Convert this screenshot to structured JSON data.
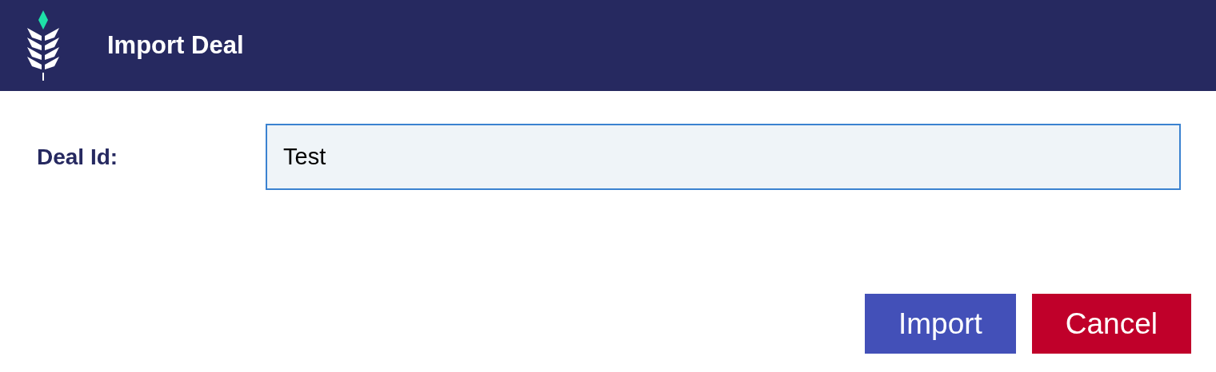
{
  "window": {
    "title": "Import Deal"
  },
  "form": {
    "label": "Deal Id:",
    "value": "Test",
    "focused": true
  },
  "buttons": [
    {
      "label": "Import",
      "kind": "primary"
    },
    {
      "label": "Cancel",
      "kind": "danger"
    }
  ]
}
